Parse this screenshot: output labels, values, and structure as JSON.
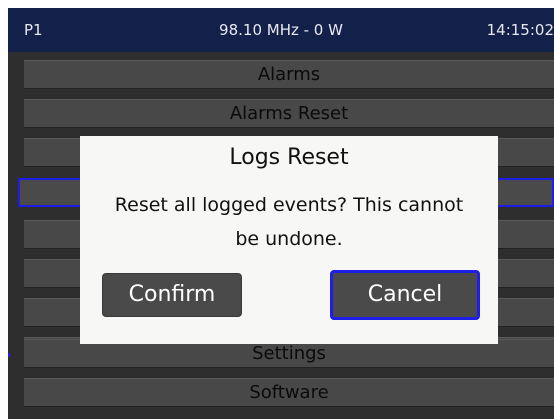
{
  "header": {
    "profile": "P1",
    "status": "98.10 MHz - 0 W",
    "clock": "14:15:02"
  },
  "menu": {
    "items": [
      {
        "label": "Alarms"
      },
      {
        "label": "Alarms Reset"
      },
      {
        "label": ""
      },
      {
        "label": ""
      },
      {
        "label": ""
      },
      {
        "label": ""
      },
      {
        "label": ""
      },
      {
        "label": ""
      },
      {
        "label": "Settings"
      },
      {
        "label": "Software"
      }
    ],
    "selected_index": 3
  },
  "dialog": {
    "title": "Logs Reset",
    "message": "Reset all logged events? This cannot be undone.",
    "confirm_label": "Confirm",
    "cancel_label": "Cancel",
    "focused_button": "cancel"
  },
  "colors": {
    "header_bg": "#13204a",
    "screen_bg": "#2e2e2e",
    "menu_item_bg": "#484848",
    "focus_border": "#1e1ee6",
    "dialog_bg": "#f7f7f5",
    "button_bg": "#4a4a4a"
  }
}
